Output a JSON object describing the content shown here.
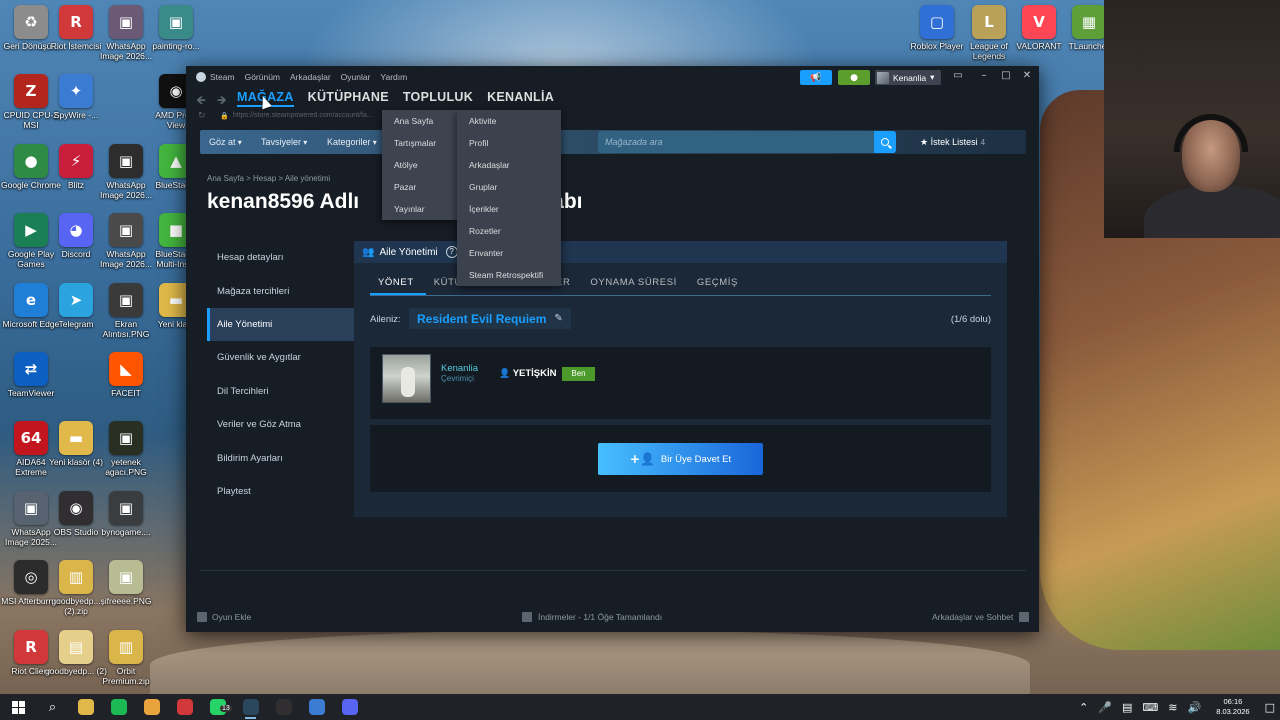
{
  "desktop": {
    "icons_left": [
      {
        "label": "Geri Dönüşü...",
        "glyph": "♻",
        "color": "#8c8c8c"
      },
      {
        "label": "CPUID CPU-Z MSI",
        "glyph": "Z",
        "color": "#b3261e"
      },
      {
        "label": "Google Chrome",
        "glyph": "●",
        "color": "#2f8a46"
      },
      {
        "label": "Google Play Games",
        "glyph": "▶",
        "color": "#1a7f54"
      },
      {
        "label": "Microsoft Edge",
        "glyph": "e",
        "color": "#1f7ed6"
      },
      {
        "label": "TeamViewer",
        "glyph": "⇄",
        "color": "#0e5fc2"
      },
      {
        "label": "AIDA64 Extreme",
        "glyph": "64",
        "color": "#c2151d"
      },
      {
        "label": "WhatsApp Image 2025...",
        "glyph": "▣",
        "color": "#566270"
      },
      {
        "label": "MSI Afterburner",
        "glyph": "◎",
        "color": "#2c2c2c"
      },
      {
        "label": "Riot Client",
        "glyph": "R",
        "color": "#d1383a"
      }
    ],
    "icons_col2": [
      {
        "label": "Riot İstemcisi",
        "glyph": "R",
        "color": "#d1383a"
      },
      {
        "label": "SpyWire -...",
        "glyph": "✦",
        "color": "#3b7bd1"
      },
      {
        "label": "Blitz",
        "glyph": "⚡",
        "color": "#c81e3c"
      },
      {
        "label": "Discord",
        "glyph": "◕",
        "color": "#5865f2"
      },
      {
        "label": "Telegram",
        "glyph": "➤",
        "color": "#2aa3df"
      },
      {
        "label": "",
        "glyph": "",
        "color": ""
      },
      {
        "label": "Yeni klasör (4)",
        "glyph": "▬",
        "color": "#e0b94a"
      },
      {
        "label": "OBS Studio",
        "glyph": "◉",
        "color": "#302e31"
      },
      {
        "label": "goodbyedp... (2).zip",
        "glyph": "▥",
        "color": "#d9b54a"
      },
      {
        "label": "goodbyedp... (2)",
        "glyph": "▤",
        "color": "#e6cf8a"
      }
    ],
    "icons_col3": [
      {
        "label": "WhatsApp Image 2026...",
        "glyph": "▣",
        "color": "#6b5a75"
      },
      {
        "label": "",
        "glyph": "",
        "color": ""
      },
      {
        "label": "WhatsApp Image 2026...",
        "glyph": "▣",
        "color": "#2d2d2d"
      },
      {
        "label": "WhatsApp Image 2026...",
        "glyph": "▣",
        "color": "#4a4a4a"
      },
      {
        "label": "Ekran Alıntısı.PNG",
        "glyph": "▣",
        "color": "#3a3a3a"
      },
      {
        "label": "FACEIT",
        "glyph": "◣",
        "color": "#ff5500"
      },
      {
        "label": "yetenek agacı.PNG",
        "glyph": "▣",
        "color": "#2a2f24"
      },
      {
        "label": "bynogame....",
        "glyph": "▣",
        "color": "#3a3d40"
      },
      {
        "label": "şifreeee.PNG",
        "glyph": "▣",
        "color": "#b7bc93"
      },
      {
        "label": "Orbit Premium.zip",
        "glyph": "▥",
        "color": "#d9b54a"
      }
    ],
    "icons_col4": [
      {
        "label": "painting-ro...",
        "glyph": "▣",
        "color": "#3b8a8a"
      },
      {
        "label": "AMD Pre... View",
        "glyph": "◉",
        "color": "#111111"
      },
      {
        "label": "BlueStac...",
        "glyph": "▲",
        "color": "#44b53f"
      },
      {
        "label": "BlueStac... Multi-Ins...",
        "glyph": "■",
        "color": "#44b53f"
      },
      {
        "label": "Yeni kla...",
        "glyph": "▬",
        "color": "#e0b94a"
      }
    ],
    "icons_right": [
      {
        "label": "Roblox Player",
        "glyph": "▢",
        "color": "#2f6fd6"
      },
      {
        "label": "League of Legends",
        "glyph": "L",
        "color": "#b9a15a"
      },
      {
        "label": "VALORANT",
        "glyph": "V",
        "color": "#ff4655"
      },
      {
        "label": "TLauncher",
        "glyph": "▦",
        "color": "#5f9f3a"
      }
    ]
  },
  "taskbar": {
    "apps": [
      {
        "name": "search-icon",
        "glyph": "⌕",
        "color": ""
      },
      {
        "name": "file-explorer-icon",
        "glyph": "",
        "color": "#e0b94a"
      },
      {
        "name": "spotify-icon",
        "glyph": "",
        "color": "#1db954"
      },
      {
        "name": "chrome-icon",
        "glyph": "",
        "color": "#e8a33d"
      },
      {
        "name": "riot-icon",
        "glyph": "",
        "color": "#d1383a"
      },
      {
        "name": "whatsapp-icon",
        "glyph": "",
        "color": "#25d366"
      },
      {
        "name": "steam-icon",
        "glyph": "",
        "color": "#2a475e"
      },
      {
        "name": "obs-icon",
        "glyph": "",
        "color": "#302e31"
      },
      {
        "name": "generic-app-icon",
        "glyph": "",
        "color": "#3b7bd1"
      },
      {
        "name": "discord-icon",
        "glyph": "",
        "color": "#5865f2"
      }
    ],
    "clock_time": "06:16",
    "clock_date": "8.03.2026",
    "whatsapp_badge": "13"
  },
  "steam": {
    "menu": [
      "Steam",
      "Görünüm",
      "Arkadaşlar",
      "Oyunlar",
      "Yardım"
    ],
    "username": "Kenanlia",
    "nav": {
      "store": "MAĞAZA",
      "library": "KÜTÜPHANE",
      "community": "TOPLULUK",
      "profile": "KENANLİA"
    },
    "url": "https://store.steampowered.com/account/fa...",
    "store_nav": {
      "browse": "Göz at",
      "recommendations": "Tavsiyeler",
      "categories": "Kategoriler"
    },
    "search_placeholder": "Mağazada ara",
    "wishlist_label": "İstek Listesi",
    "wishlist_count": "4",
    "breadcrumb": "Ana Sayfa > Hesap > Aile yönetimi",
    "page_title_left": "kenan8596 Adlı",
    "page_title_right": "abı",
    "sidebar": [
      "Hesap detayları",
      "Mağaza tercihleri",
      "Aile Yönetimi",
      "Güvenlik ve Aygıtlar",
      "Dil Tercihleri",
      "Veriler ve Göz Atma",
      "Bildirim Ayarları",
      "Playtest"
    ],
    "family_header": "Aile Yönetimi",
    "tabs": [
      "YÖNET",
      "KÜTÜPHANE",
      "TALEPLER",
      "OYNAMA SÜRESİ",
      "GEÇMİŞ"
    ],
    "family_label": "Aileniz:",
    "family_name": "Resident Evil Requiem",
    "family_count": "(1/6 dolu)",
    "member": {
      "name": "Kenanlia",
      "status": "Çevrimiçi",
      "role": "YETİŞKİN",
      "badge": "Ben"
    },
    "invite_label": "Bir Üye Davet Et",
    "store_dropdown": [
      "Ana Sayfa",
      "Tartışmalar",
      "Atölye",
      "Pazar",
      "Yayınlar"
    ],
    "user_dropdown": [
      "Aktivite",
      "Profil",
      "Arkadaşlar",
      "Gruplar",
      "İçerikler",
      "Rozetler",
      "Envanter",
      "Steam Retrospektifi"
    ],
    "bottom": {
      "add_game": "Oyun Ekle",
      "downloads": "İndirmeler - 1/1 Öğe Tamamlandı",
      "friends": "Arkadaşlar ve Sohbet"
    }
  }
}
